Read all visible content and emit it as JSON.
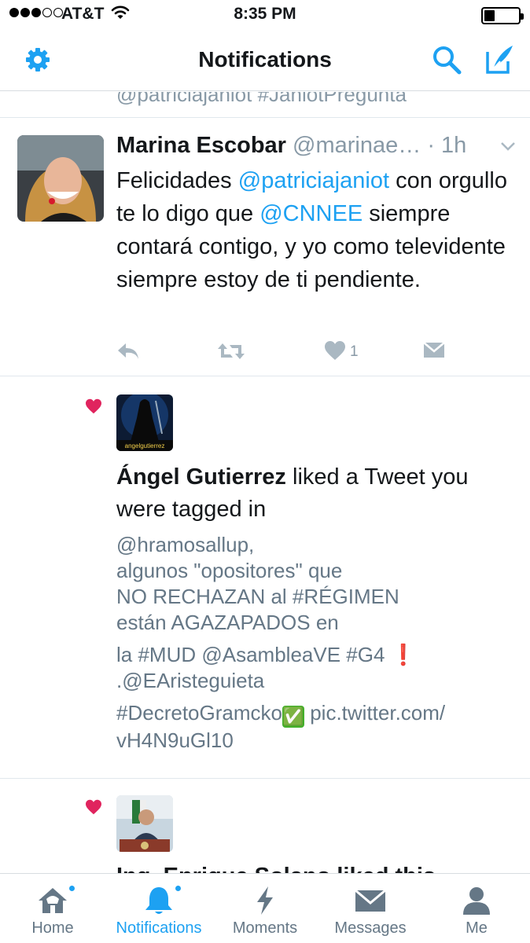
{
  "status_bar": {
    "carrier": "AT&T",
    "time": "8:35 PM",
    "signal_bars_filled": 3,
    "signal_bars_total": 5,
    "battery_level": 0.3
  },
  "nav": {
    "title": "Notifications",
    "left_icon": "gear-icon",
    "right_icons": [
      "search-icon",
      "compose-icon"
    ]
  },
  "feed": {
    "clipped_text": "@patriciajaniot #JaniotPregunta",
    "tweet": {
      "name": "Marina Escobar",
      "handle": "@marinae…",
      "time": "· 1h",
      "text_parts": [
        "Felicidades ",
        "@patriciajaniot",
        " con orgullo te lo digo que ",
        "@CNNEE",
        " siempre contará contigo, y yo como televidente siempre estoy de ti pendiente."
      ],
      "like_count": "1",
      "actions": [
        "reply-icon",
        "retweet-icon",
        "like-icon",
        "direct-message-icon"
      ]
    },
    "like_notification": {
      "name": "Ángel Gutierrez",
      "action": " liked a Tweet you were tagged in",
      "avatar_label": "angelgutierrez",
      "quoted_lines": [
        "@hramosallup,",
        "algunos \"opositores\" que",
        "NO RECHAZAN al #RÉGIMEN",
        "están AGAZAPADOS en",
        "la #MUD @AsambleaVE #G4",
        ".@EAristeguieta",
        "#DecretoGramcko",
        "pic.twitter.com/",
        "vH4N9uGl10"
      ],
      "quoted_emoji": [
        "❗",
        "✅"
      ]
    },
    "partial_notification": {
      "clipped_title": "Ing. Enrique Solano liked this"
    }
  },
  "tabbar": {
    "tabs": [
      {
        "label": "Home",
        "icon": "home-icon",
        "badge": true,
        "active": false
      },
      {
        "label": "Notifications",
        "icon": "bell-icon",
        "badge": true,
        "active": true
      },
      {
        "label": "Moments",
        "icon": "lightning-icon",
        "badge": false,
        "active": false
      },
      {
        "label": "Messages",
        "icon": "envelope-icon",
        "badge": false,
        "active": false
      },
      {
        "label": "Me",
        "icon": "person-icon",
        "badge": false,
        "active": false
      }
    ]
  },
  "colors": {
    "accent": "#1da1f2",
    "heart": "#e0245e",
    "muted": "#8899a6"
  }
}
